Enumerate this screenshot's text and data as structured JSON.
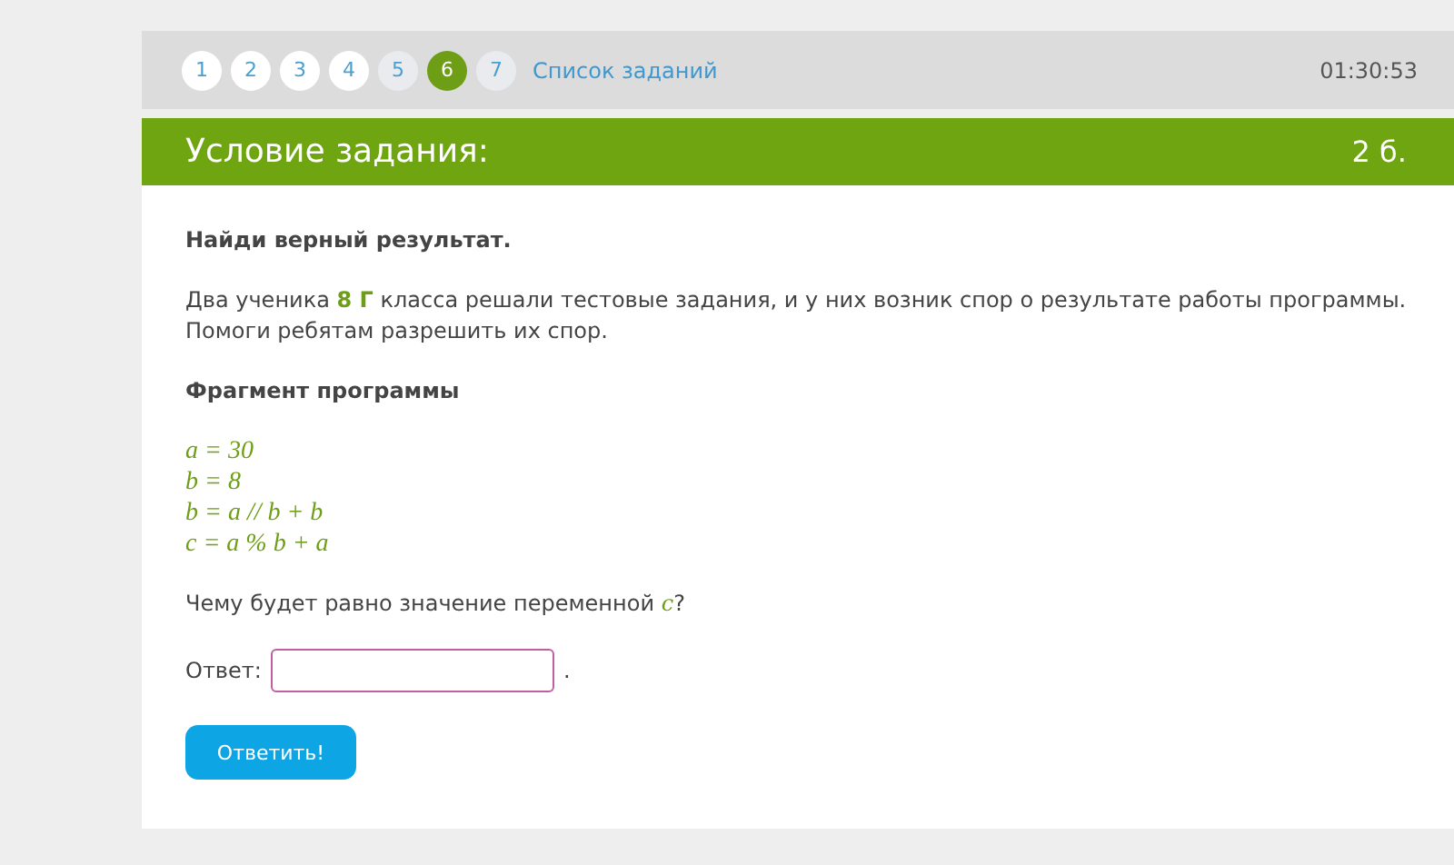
{
  "nav": {
    "items": [
      {
        "label": "1",
        "selected": false,
        "answered": true
      },
      {
        "label": "2",
        "selected": false,
        "answered": true
      },
      {
        "label": "3",
        "selected": false,
        "answered": true
      },
      {
        "label": "4",
        "selected": false,
        "answered": true
      },
      {
        "label": "5",
        "selected": false,
        "answered": false
      },
      {
        "label": "6",
        "selected": true,
        "answered": false
      },
      {
        "label": "7",
        "selected": false,
        "answered": false
      }
    ],
    "list_link": "Список заданий",
    "timer": "01:30:53"
  },
  "header": {
    "title": "Условие задания:",
    "points": "2 б."
  },
  "task": {
    "instruction": "Найди верный результат.",
    "paragraph": [
      {
        "kind": "plain",
        "text": "Два ученика "
      },
      {
        "kind": "highlight",
        "text": "8 Г"
      },
      {
        "kind": "plain",
        "text": " класса решали тестовые задания, и у них возник спор о результате работы программы. Помоги ребятам разрешить их спор."
      }
    ],
    "fragment_title": "Фрагмент программы",
    "code": [
      "a = 30",
      "b = 8",
      "b = a // b + b",
      "c = a % b + a"
    ],
    "question": [
      {
        "kind": "plain",
        "text": "Чему будет равно значение переменной "
      },
      {
        "kind": "math",
        "text": "c"
      },
      {
        "kind": "plain",
        "text": "?"
      }
    ],
    "answer": {
      "label": "Ответ:",
      "focused": true,
      "after": "."
    },
    "submit": "Ответить!"
  }
}
